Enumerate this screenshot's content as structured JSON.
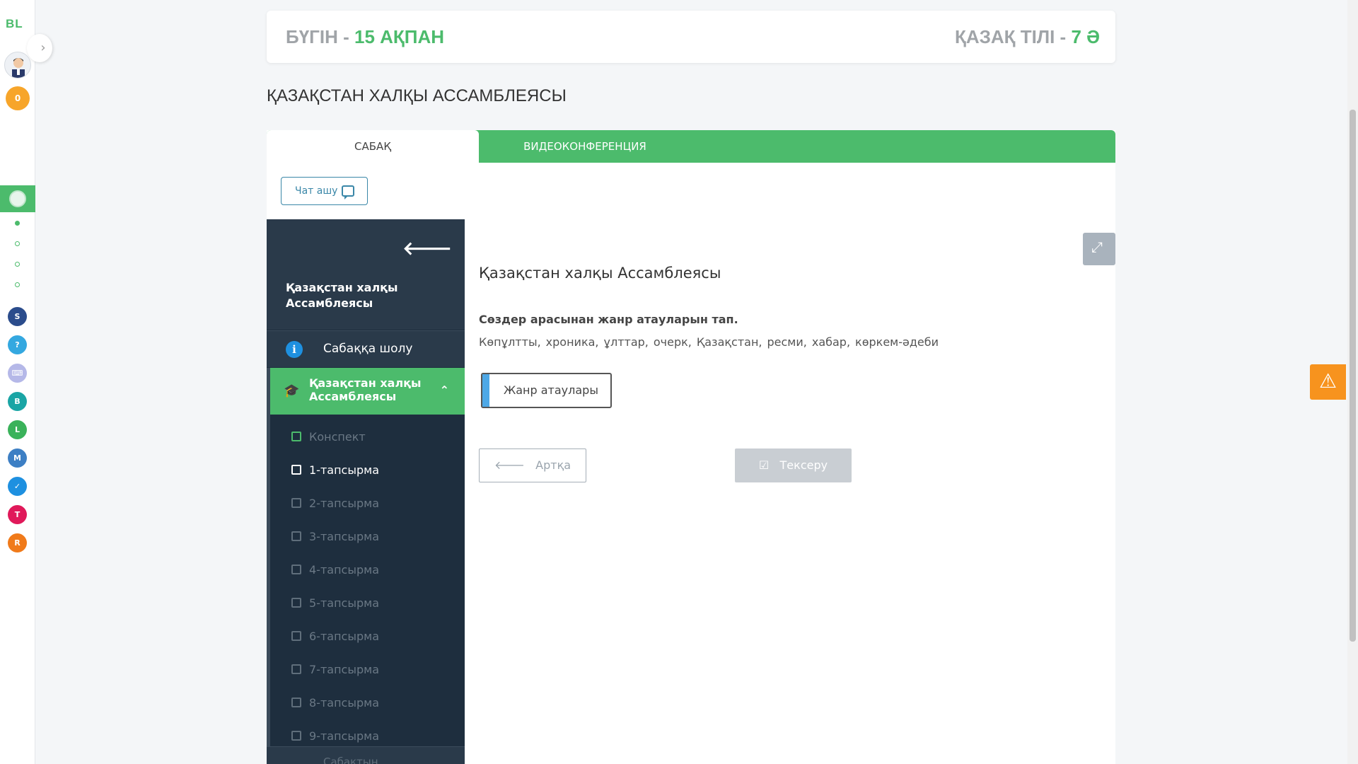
{
  "rail": {
    "logo": "BL",
    "coins": "0",
    "apps": [
      {
        "name": "smart-nation-app",
        "color": "#2b4c8c",
        "glyph": "S"
      },
      {
        "name": "help-app",
        "color": "#34a8e0",
        "glyph": "?"
      },
      {
        "name": "keyboard-app",
        "color": "#b5b8e8",
        "glyph": "⌨"
      },
      {
        "name": "bilim-tv-app",
        "color": "#1aa5a5",
        "glyph": "B"
      },
      {
        "name": "bilim-land-app",
        "color": "#3ab25a",
        "glyph": "L"
      },
      {
        "name": "bilim-media-app",
        "color": "#3d7fc4",
        "glyph": "M"
      },
      {
        "name": "test-app",
        "color": "#1e90e0",
        "glyph": "✓"
      },
      {
        "name": "twig-app",
        "color": "#e0195a",
        "glyph": "T"
      },
      {
        "name": "radio-app",
        "color": "#f07a1a",
        "glyph": "R"
      }
    ]
  },
  "header": {
    "today_label": "БҮГІН - ",
    "today_date": "15 АҚПАН",
    "subject_label": "ҚАЗАҚ ТІЛІ - ",
    "subject_grade": "7 Ә"
  },
  "page_title": "ҚАЗАҚСТАН ХАЛҚЫ АССАМБЛЕЯСЫ",
  "tabs": {
    "lesson": "САБАҚ",
    "video": "ВИДЕОКОНФЕРЕНЦИЯ"
  },
  "chat_button": "Чат ашу",
  "sidebar": {
    "title": "Қазақстан халқы Ассамблеясы",
    "overview": "Сабаққа шолу",
    "active_section": "Қазақстан халқы Ассамблеясы",
    "items": [
      {
        "label": "Конспект"
      },
      {
        "label": "1-тапсырма"
      },
      {
        "label": "2-тапсырма"
      },
      {
        "label": "3-тапсырма"
      },
      {
        "label": "4-тапсырма"
      },
      {
        "label": "5-тапсырма"
      },
      {
        "label": "6-тапсырма"
      },
      {
        "label": "7-тапсырма"
      },
      {
        "label": "8-тапсырма"
      },
      {
        "label": "9-тапсырма"
      }
    ],
    "bottom_label": "Сабақтың"
  },
  "task": {
    "title": "Қазақстан халқы Ассамблеясы",
    "instruction": "Сөздер арасынан жанр атауларын тап.",
    "words": [
      "Көпұлтты,",
      "хроника,",
      "ұлттар,",
      "очерк,",
      "Қазақстан,",
      "ресми,",
      "хабар,",
      "көркем-әдеби"
    ],
    "drop_label": "Жанр атаулары",
    "back_button": "Артқа",
    "check_button": "Тексеру"
  }
}
